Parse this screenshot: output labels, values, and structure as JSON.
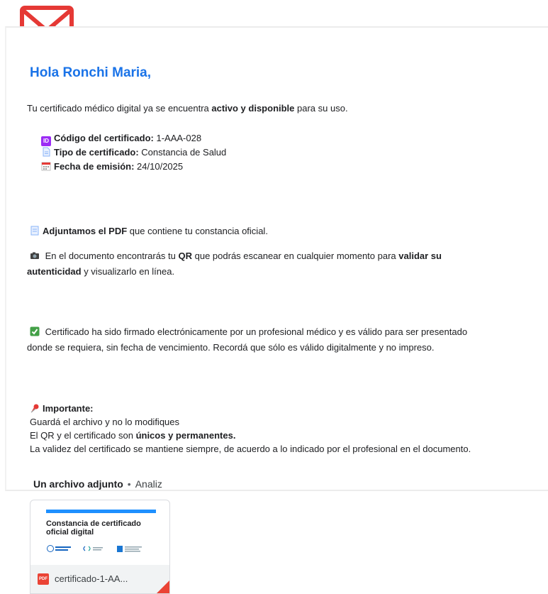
{
  "header": {
    "icon": "envelope-icon",
    "icon_color": "#e53935"
  },
  "email": {
    "greeting": "Hola Ronchi Maria,",
    "intro": {
      "text_a": "Tu certificado médico digital ya se encuentra ",
      "bold": "activo y disponible",
      "text_b": " para su uso."
    },
    "details": [
      {
        "icon": "id-icon",
        "label": "Código del certificado:",
        "value": "1-AAA-028"
      },
      {
        "icon": "document-icon",
        "label": "Tipo de certificado:",
        "value": "Constancia de Salud"
      },
      {
        "icon": "calendar-icon",
        "label": "Fecha de emisión:",
        "value": "24/10/2025"
      }
    ],
    "pdf_note": {
      "bold": "Adjuntamos el PDF",
      "text": " que contiene tu constancia oficial."
    },
    "qr_note": {
      "text_a": " En el documento encontrarás tu ",
      "bold_a": "QR",
      "text_b": " que podrás escanear en cualquier momento para ",
      "bold_b": "validar su",
      "line2_bold": "autenticidad",
      "line2_text": " y visualizarlo en línea."
    },
    "signed_note": {
      "line1": " Certificado ha sido firmado electrónicamente por un profesional médico y es válido para ser presentado",
      "line2": "donde se requiera, sin fecha de vencimiento. Recordá que sólo es válido digitalmente y no impreso."
    },
    "important": {
      "title": "Importante:",
      "line1": "Guardá el archivo y no lo modifiques",
      "line2_a": "El QR y el certificado son ",
      "line2_bold": "únicos y permanentes.",
      "line3": "La validez del certificado se mantiene siempre, de acuerdo a lo indicado por el profesional en el documento."
    }
  },
  "attachments": {
    "header": "Un archivo adjunto",
    "separator": "•",
    "status": "Analiz",
    "items": [
      {
        "preview_title": "Constancia de certificado oficial digital",
        "file_type": "PDF",
        "file_name": "certificado-1-AA..."
      }
    ]
  }
}
